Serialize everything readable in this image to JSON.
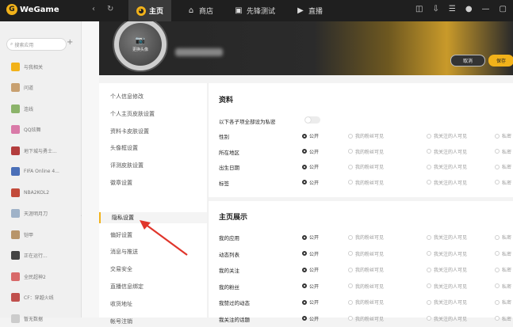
{
  "app": {
    "name": "WeGame"
  },
  "nav": {
    "tabs": [
      {
        "label": "主页",
        "icon": "wegame-home-icon"
      },
      {
        "label": "商店",
        "icon": "store-icon"
      },
      {
        "label": "先锋测试",
        "icon": "gamepad-icon"
      },
      {
        "label": "直播",
        "icon": "live-icon"
      }
    ]
  },
  "sidebar": {
    "search_placeholder": "搜索应用",
    "games": [
      {
        "label": "与我相关",
        "color": "#f2b21a"
      },
      {
        "label": "问道",
        "color": "#c8a070"
      },
      {
        "label": "连线",
        "color": "#8bb36a"
      },
      {
        "label": "QQ炫舞",
        "color": "#d97aa8"
      },
      {
        "label": "地下城与勇士...",
        "color": "#b33d3d"
      },
      {
        "label": "FIFA Online 4...",
        "color": "#4a6fb8"
      },
      {
        "label": "NBA2KOL2",
        "color": "#c24a3a"
      },
      {
        "label": "天涯明月刀",
        "color": "#9fb2c8"
      },
      {
        "label": "铠甲",
        "color": "#b8956a"
      },
      {
        "label": "正在运行...",
        "color": "#444444"
      },
      {
        "label": "全民超神2",
        "color": "#d86a6a"
      },
      {
        "label": "CF：穿越火线",
        "color": "#c0504d"
      },
      {
        "label": "暂无数据",
        "color": "#cccccc"
      }
    ]
  },
  "profile": {
    "avatar_label": "更换头像",
    "cancel_label": "取消",
    "save_label": "保存"
  },
  "submenu": {
    "items": [
      "个人信息修改",
      "个人主页皮肤设置",
      "资料卡皮肤设置",
      "头像框设置",
      "评测皮肤设置",
      "徽章设置",
      "隐私设置",
      "偏好设置",
      "消息与推送",
      "交易安全",
      "直播信息绑定",
      "收货地址",
      "帐号注销"
    ],
    "active_index": 6
  },
  "privacy": {
    "section1": {
      "title": "资料",
      "toggle_label": "以下各子项全部设为私密",
      "rows": [
        {
          "label": "性别",
          "selected": 0
        },
        {
          "label": "所在地区",
          "selected": 0
        },
        {
          "label": "出生日期",
          "selected": 0
        },
        {
          "label": "标签",
          "selected": 0
        }
      ]
    },
    "section2": {
      "title": "主页展示",
      "rows": [
        {
          "label": "我的应用",
          "selected": 0
        },
        {
          "label": "动态列表",
          "selected": 0
        },
        {
          "label": "我的关注",
          "selected": 0
        },
        {
          "label": "我的粉丝",
          "selected": 0
        },
        {
          "label": "我赞过的动态",
          "selected": 0
        },
        {
          "label": "我关注的话题",
          "selected": 0
        }
      ]
    },
    "options": [
      "公开",
      "我的粉丝可见",
      "我关注的人可见",
      "私密"
    ]
  }
}
